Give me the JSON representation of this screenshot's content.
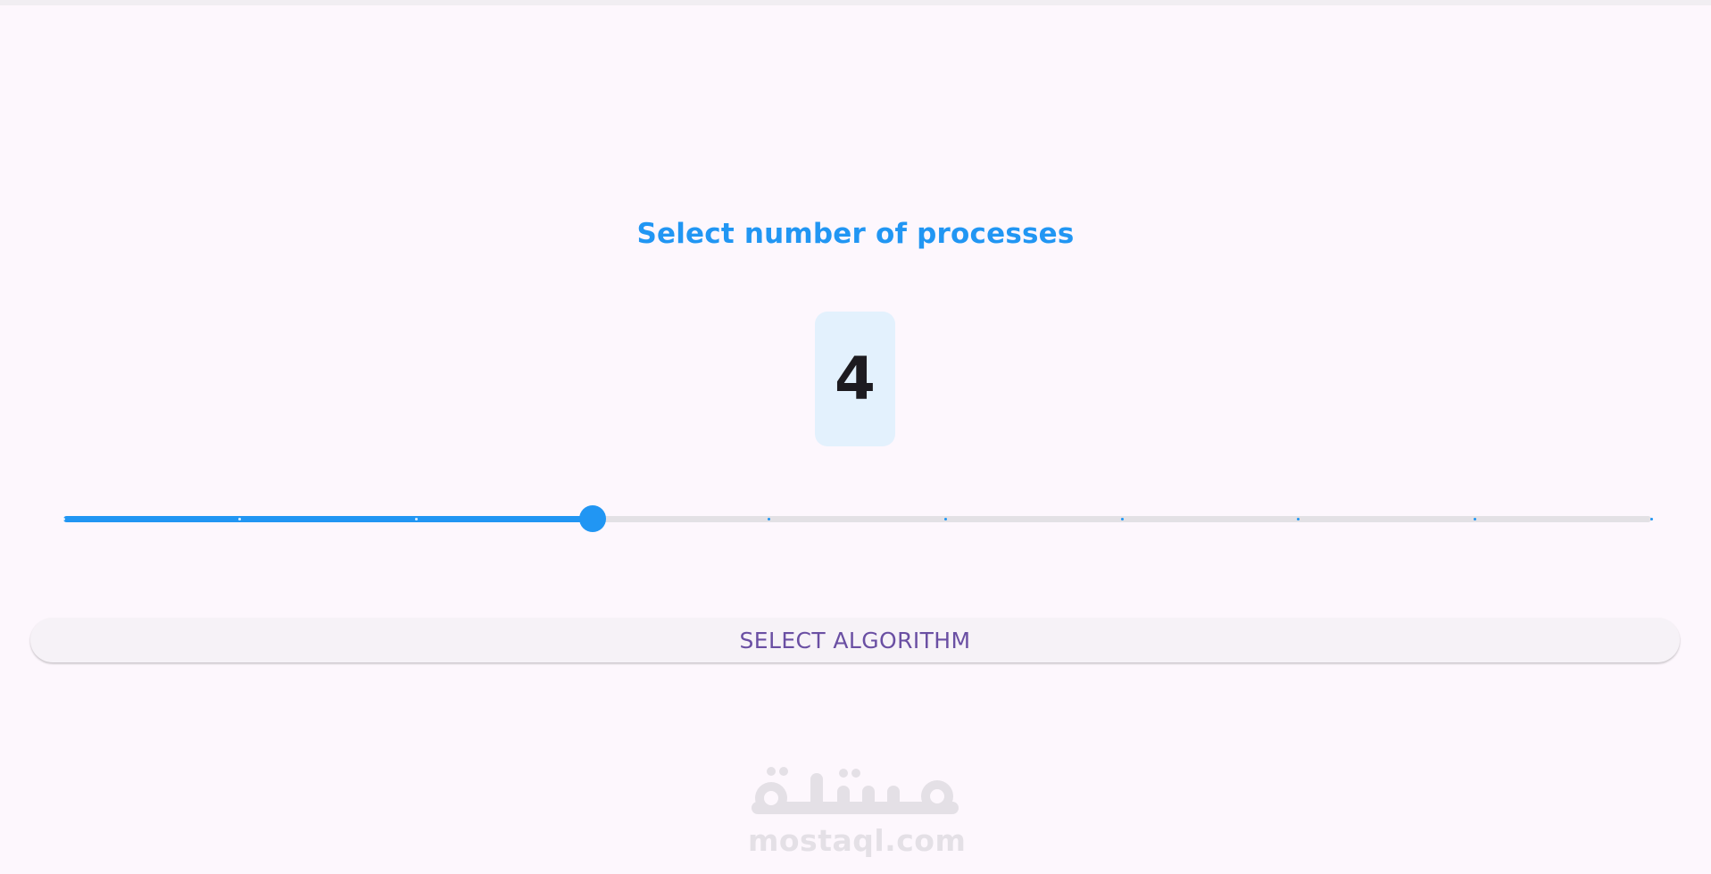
{
  "heading": "Select number of processes",
  "selected_value": "4",
  "slider": {
    "min": 1,
    "max": 10,
    "value": 4,
    "active_color": "#2196f3",
    "inactive_color": "#e3e1e5"
  },
  "select_button": {
    "label": "SELECT ALGORITHM"
  },
  "watermark": {
    "brand_name": "مستقل",
    "domain": "mostaql.com"
  },
  "colors": {
    "accent": "#2196f3",
    "button_text": "#6a4fa3",
    "background": "#fdf7fd",
    "value_box": "#e3f1fd"
  }
}
